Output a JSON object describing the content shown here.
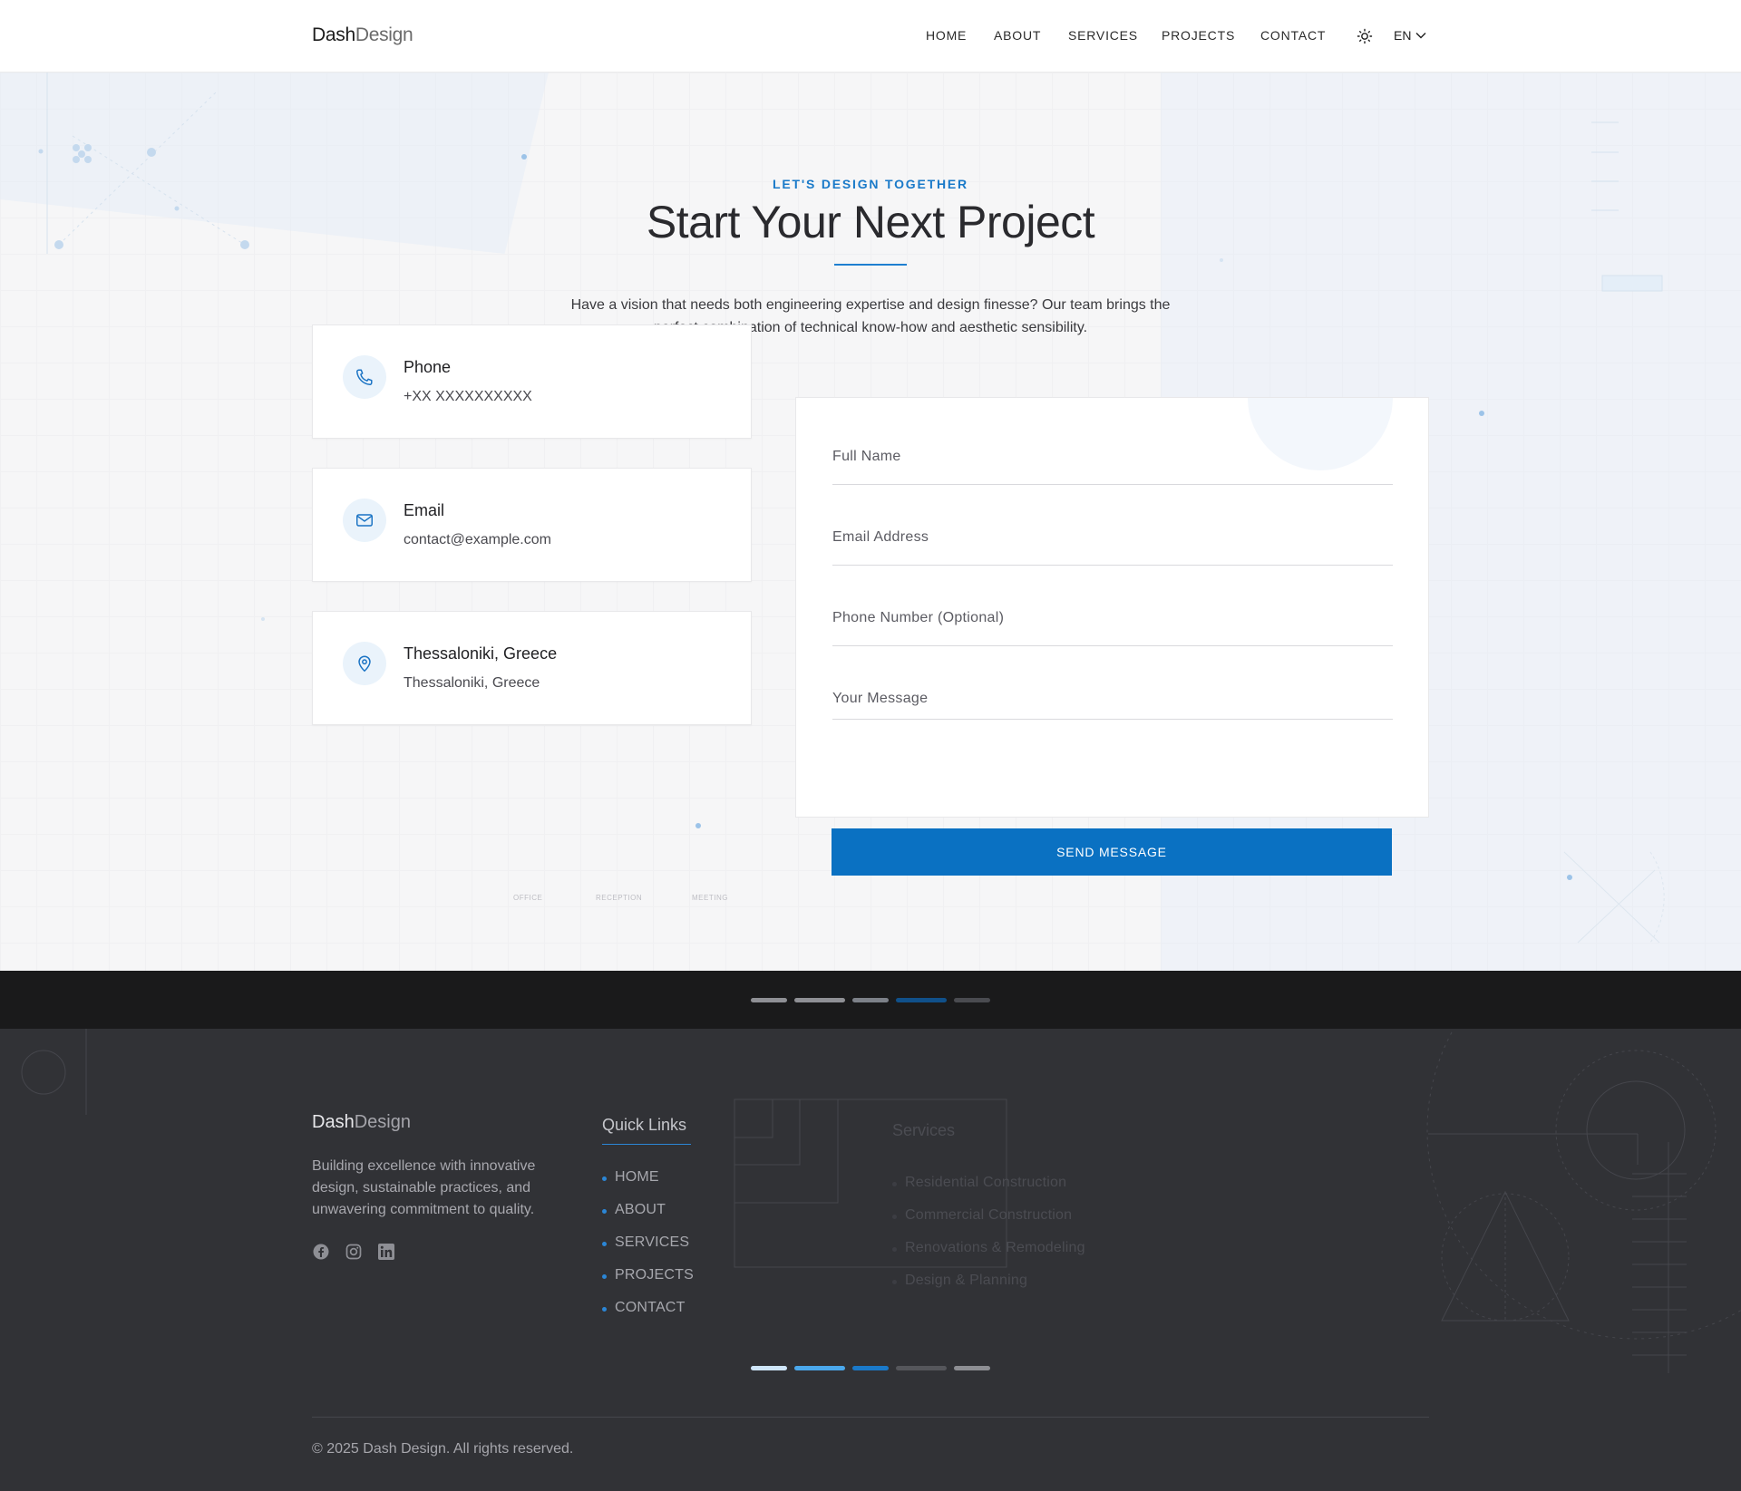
{
  "header": {
    "logo_part1": "Dash",
    "logo_part2": "Design",
    "nav": [
      "HOME",
      "ABOUT",
      "SERVICES",
      "PROJECTS",
      "CONTACT"
    ],
    "theme_icon": "sun-icon",
    "language": "EN",
    "language_icon": "chevron-down-icon"
  },
  "hero": {
    "eyebrow": "LET'S DESIGN TOGETHER",
    "title": "Start Your Next Project",
    "intro": "Have a vision that needs both engineering expertise and design finesse? Our team brings the perfect combination of technical know-how and aesthetic sensibility.",
    "floor_labels": [
      "OFFICE",
      "RECEPTION",
      "MEETING"
    ]
  },
  "contact_cards": [
    {
      "icon": "phone-icon",
      "title": "Phone",
      "value": "+XX XXXXXXXXXX"
    },
    {
      "icon": "mail-icon",
      "title": "Email",
      "value": "contact@example.com"
    },
    {
      "icon": "location-pin-icon",
      "title": "Thessaloniki, Greece",
      "value": "Thessaloniki, Greece"
    }
  ],
  "form": {
    "full_name_placeholder": "Full Name",
    "email_placeholder": "Email Address",
    "phone_placeholder": "Phone Number (Optional)",
    "message_placeholder": "Your Message",
    "submit_label": "SEND MESSAGE"
  },
  "footer": {
    "logo_part1": "Dash",
    "logo_part2": "Design",
    "description": "Building excellence with innovative design, sustainable practices, and unwavering commitment to quality.",
    "social_icons": [
      "facebook-icon",
      "instagram-icon",
      "linkedin-icon"
    ],
    "quick_links_heading": "Quick Links",
    "quick_links": [
      "HOME",
      "ABOUT",
      "SERVICES",
      "PROJECTS",
      "CONTACT"
    ],
    "services_heading": "Services",
    "services": [
      "Residential Construction",
      "Commercial Construction",
      "Renovations & Remodeling",
      "Design & Planning"
    ],
    "copyright": "© 2025 Dash Design. All rights reserved."
  },
  "colors": {
    "accent": "#0a71c2",
    "eyebrow": "#1a7ac9",
    "footer_bg": "#313236",
    "band_bg": "#1a1a1b"
  }
}
